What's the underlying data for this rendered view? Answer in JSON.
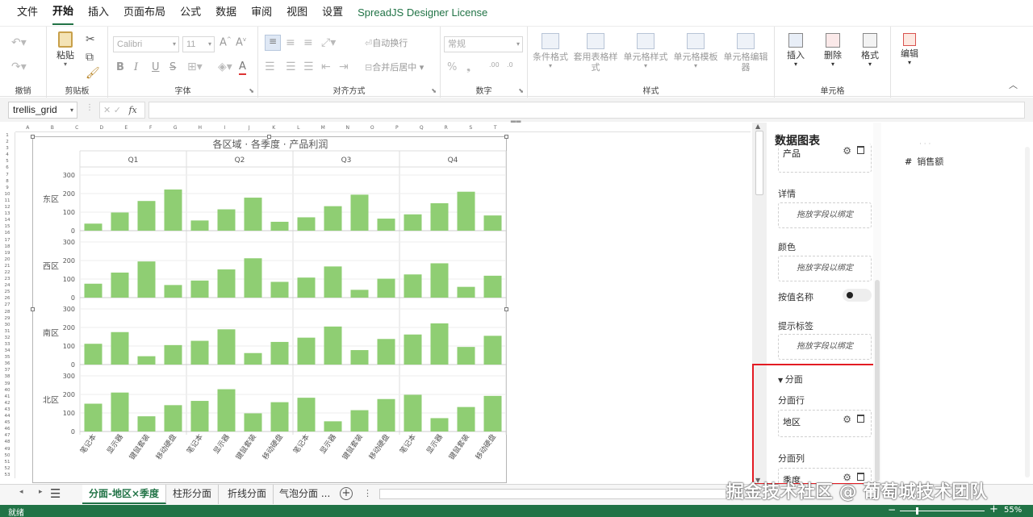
{
  "menu": {
    "items": [
      "文件",
      "开始",
      "插入",
      "页面布局",
      "公式",
      "数据",
      "审阅",
      "视图",
      "设置"
    ],
    "active_index": 1,
    "license": "SpreadJS Designer License"
  },
  "ribbon": {
    "groups": {
      "undo": "撤销",
      "clipboard": "剪贴板",
      "font": "字体",
      "align": "对齐方式",
      "number": "数字",
      "style": "样式",
      "cells": "单元格"
    },
    "paste": "粘贴",
    "font_name": "Calibri",
    "font_size": "11",
    "wrap_text": "自动换行",
    "merge_center": "合并后居中",
    "number_format": "常规",
    "cond_format": "条件格式",
    "table_style": "套用表格样式",
    "cell_style": "单元格样式",
    "cell_template": "单元格模板",
    "cell_editor": "单元格编辑器",
    "insert": "插入",
    "delete": "删除",
    "format": "格式",
    "edit": "编辑",
    "bold": "B",
    "italic": "I",
    "underline": "U"
  },
  "formula_bar": {
    "name_box": "trellis_grid",
    "fx": "fx"
  },
  "sheet": {
    "columns": [
      "A",
      "B",
      "C",
      "D",
      "E",
      "F",
      "G",
      "H",
      "I",
      "J",
      "K",
      "L",
      "M",
      "N",
      "O",
      "P",
      "Q",
      "R",
      "S",
      "T"
    ],
    "rows": [
      "1",
      "2",
      "3",
      "4",
      "5",
      "6",
      "7",
      "8",
      "9",
      "10",
      "11",
      "12",
      "13",
      "14",
      "15",
      "16",
      "17",
      "18",
      "19",
      "20",
      "21",
      "22",
      "23",
      "24",
      "25",
      "26",
      "27",
      "28",
      "29",
      "30",
      "31",
      "32",
      "33",
      "34",
      "35",
      "36",
      "37",
      "38",
      "39",
      "40",
      "41",
      "42",
      "43",
      "44",
      "45",
      "46",
      "47",
      "48",
      "49",
      "50",
      "51",
      "52",
      "53"
    ]
  },
  "chart_data": {
    "type": "bar",
    "title": "各区域 · 各季度 · 产品利润",
    "facet_columns": [
      "Q1",
      "Q2",
      "Q3",
      "Q4"
    ],
    "facet_rows": [
      "东区",
      "西区",
      "南区",
      "北区"
    ],
    "categories": [
      "笔记本",
      "显示器",
      "键鼠套装",
      "移动硬盘"
    ],
    "y_ticks": [
      "0",
      "100",
      "200",
      "300"
    ],
    "ylim": [
      0,
      300
    ],
    "bar_color": "#8fce73",
    "values": [
      [
        [
          38,
          98,
          160,
          222
        ],
        [
          55,
          115,
          178,
          48
        ],
        [
          72,
          132,
          194,
          65
        ],
        [
          88,
          148,
          210,
          82
        ]
      ],
      [
        [
          75,
          135,
          195,
          68
        ],
        [
          92,
          152,
          212,
          85
        ],
        [
          108,
          168,
          42,
          102
        ],
        [
          125,
          185,
          58,
          118
        ]
      ],
      [
        [
          112,
          175,
          45,
          105
        ],
        [
          128,
          190,
          62,
          122
        ],
        [
          145,
          205,
          78,
          138
        ],
        [
          162,
          222,
          95,
          155
        ]
      ],
      [
        [
          150,
          210,
          82,
          142
        ],
        [
          165,
          228,
          98,
          158
        ],
        [
          182,
          55,
          115,
          175
        ],
        [
          198,
          72,
          132,
          192
        ]
      ]
    ]
  },
  "panel": {
    "title": "数据图表",
    "product_field": "产品",
    "detail_label": "详情",
    "color_label": "颜色",
    "drop_hint": "拖放字段以绑定",
    "by_value_label": "按值名称",
    "tooltip_label": "提示标签",
    "facet_section": "分面",
    "facet_row_label": "分面行",
    "facet_row_field": "地区",
    "facet_col_label": "分面列",
    "facet_col_field": "季度",
    "highlight_color": "#e31b23"
  },
  "field_list": {
    "item": "销售额",
    "type_symbol": "#"
  },
  "tabs": {
    "items": [
      "分面-地区×季度",
      "柱形分面",
      "折线分面",
      "气泡分面"
    ],
    "more": "...",
    "add": "+"
  },
  "watermark": "掘金技术社区 @ 葡萄城技术团队",
  "status": {
    "text": "就绪",
    "zoom": "55%"
  }
}
